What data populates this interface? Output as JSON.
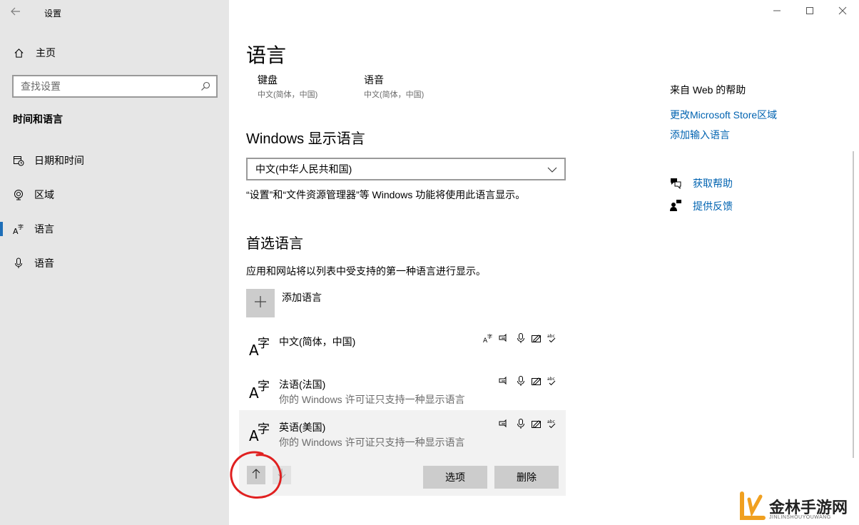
{
  "window": {
    "title": "设置",
    "minimize_icon": "minimize-icon",
    "maximize_icon": "maximize-icon",
    "close_icon": "close-icon"
  },
  "sidebar": {
    "home_label": "主页",
    "search_placeholder": "查找设置",
    "section_label": "时间和语言",
    "items": [
      {
        "label": "日期和时间",
        "icon": "calendar-clock-icon"
      },
      {
        "label": "区域",
        "icon": "globe-icon"
      },
      {
        "label": "语言",
        "icon": "language-icon",
        "active": true
      },
      {
        "label": "语音",
        "icon": "microphone-icon"
      }
    ]
  },
  "main": {
    "title": "语言",
    "shortcuts": [
      {
        "title": "键盘",
        "subtitle": "中文(简体，中国)"
      },
      {
        "title": "语音",
        "subtitle": "中文(简体，中国)"
      }
    ],
    "display_language": {
      "heading": "Windows 显示语言",
      "selected": "中文(中华人民共和国)",
      "description": "“设置”和“文件资源管理器”等 Windows 功能将使用此语言显示。"
    },
    "preferred": {
      "heading": "首选语言",
      "description": "应用和网站将以列表中受支持的第一种语言进行显示。",
      "add_label": "添加语言",
      "languages": [
        {
          "name": "中文(简体，中国)",
          "note": "",
          "features": [
            "display-language-icon",
            "speech-icon",
            "microphone-icon",
            "handwriting-icon",
            "spellcheck-icon"
          ]
        },
        {
          "name": "法语(法国)",
          "note": "你的 Windows 许可证只支持一种显示语言",
          "features": [
            "speech-icon",
            "microphone-icon",
            "handwriting-icon",
            "spellcheck-icon"
          ]
        },
        {
          "name": "英语(美国)",
          "note": "你的 Windows 许可证只支持一种显示语言",
          "features": [
            "speech-icon",
            "microphone-icon",
            "handwriting-icon",
            "spellcheck-icon"
          ]
        }
      ],
      "options_label": "选项",
      "remove_label": "删除"
    }
  },
  "help": {
    "title": "来自 Web 的帮助",
    "links": [
      "更改Microsoft Store区域",
      "添加输入语言"
    ],
    "get_help": "获取帮助",
    "feedback": "提供反馈"
  },
  "watermark": {
    "text": "金林手游网",
    "sub": "JINLINSHOUYOUWANG"
  }
}
